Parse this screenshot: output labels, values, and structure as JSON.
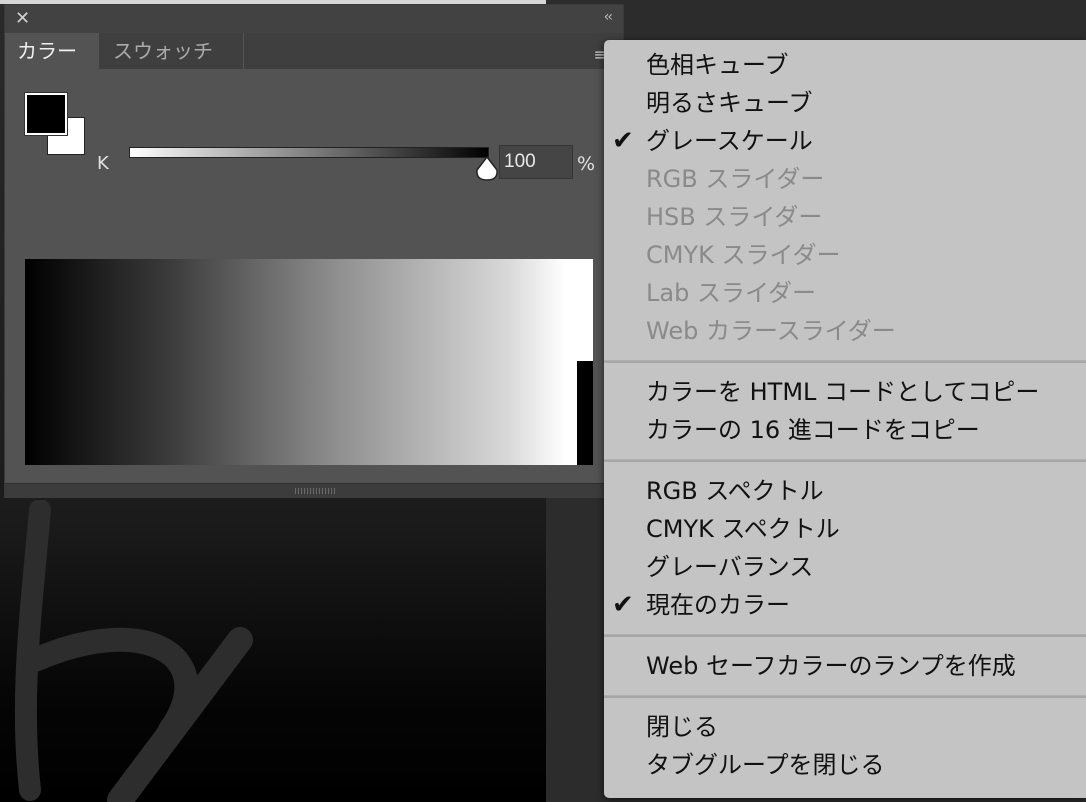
{
  "panel": {
    "close_glyph": "✕",
    "collapse_glyph": "‹‹",
    "tabs": [
      {
        "label": "カラー",
        "active": true
      },
      {
        "label": "スウォッチ",
        "active": false
      }
    ],
    "menu_glyph": "≡",
    "slider": {
      "channel_label": "K",
      "value": "100",
      "unit": "%",
      "level": 1.0
    },
    "foreground_color": "#000000",
    "background_color": "#ffffff"
  },
  "menu": {
    "check_glyph": "✔",
    "groups": [
      [
        {
          "label": "色相キューブ",
          "checked": false,
          "enabled": true
        },
        {
          "label": "明るさキューブ",
          "checked": false,
          "enabled": true
        },
        {
          "label": "グレースケール",
          "checked": true,
          "enabled": true
        },
        {
          "label": "RGB スライダー",
          "checked": false,
          "enabled": false
        },
        {
          "label": "HSB スライダー",
          "checked": false,
          "enabled": false
        },
        {
          "label": "CMYK スライダー",
          "checked": false,
          "enabled": false
        },
        {
          "label": "Lab スライダー",
          "checked": false,
          "enabled": false
        },
        {
          "label": "Web カラースライダー",
          "checked": false,
          "enabled": false
        }
      ],
      [
        {
          "label": "カラーを HTML コードとしてコピー",
          "checked": false,
          "enabled": true
        },
        {
          "label": "カラーの 16 進コードをコピー",
          "checked": false,
          "enabled": true
        }
      ],
      [
        {
          "label": "RGB スペクトル",
          "checked": false,
          "enabled": true
        },
        {
          "label": "CMYK スペクトル",
          "checked": false,
          "enabled": true
        },
        {
          "label": "グレーバランス",
          "checked": false,
          "enabled": true
        },
        {
          "label": "現在のカラー",
          "checked": true,
          "enabled": true
        }
      ],
      [
        {
          "label": "Web セーフカラーのランプを作成",
          "checked": false,
          "enabled": true
        }
      ],
      [
        {
          "label": "閉じる",
          "checked": false,
          "enabled": true
        },
        {
          "label": "タブグループを閉じる",
          "checked": false,
          "enabled": true
        }
      ]
    ]
  }
}
